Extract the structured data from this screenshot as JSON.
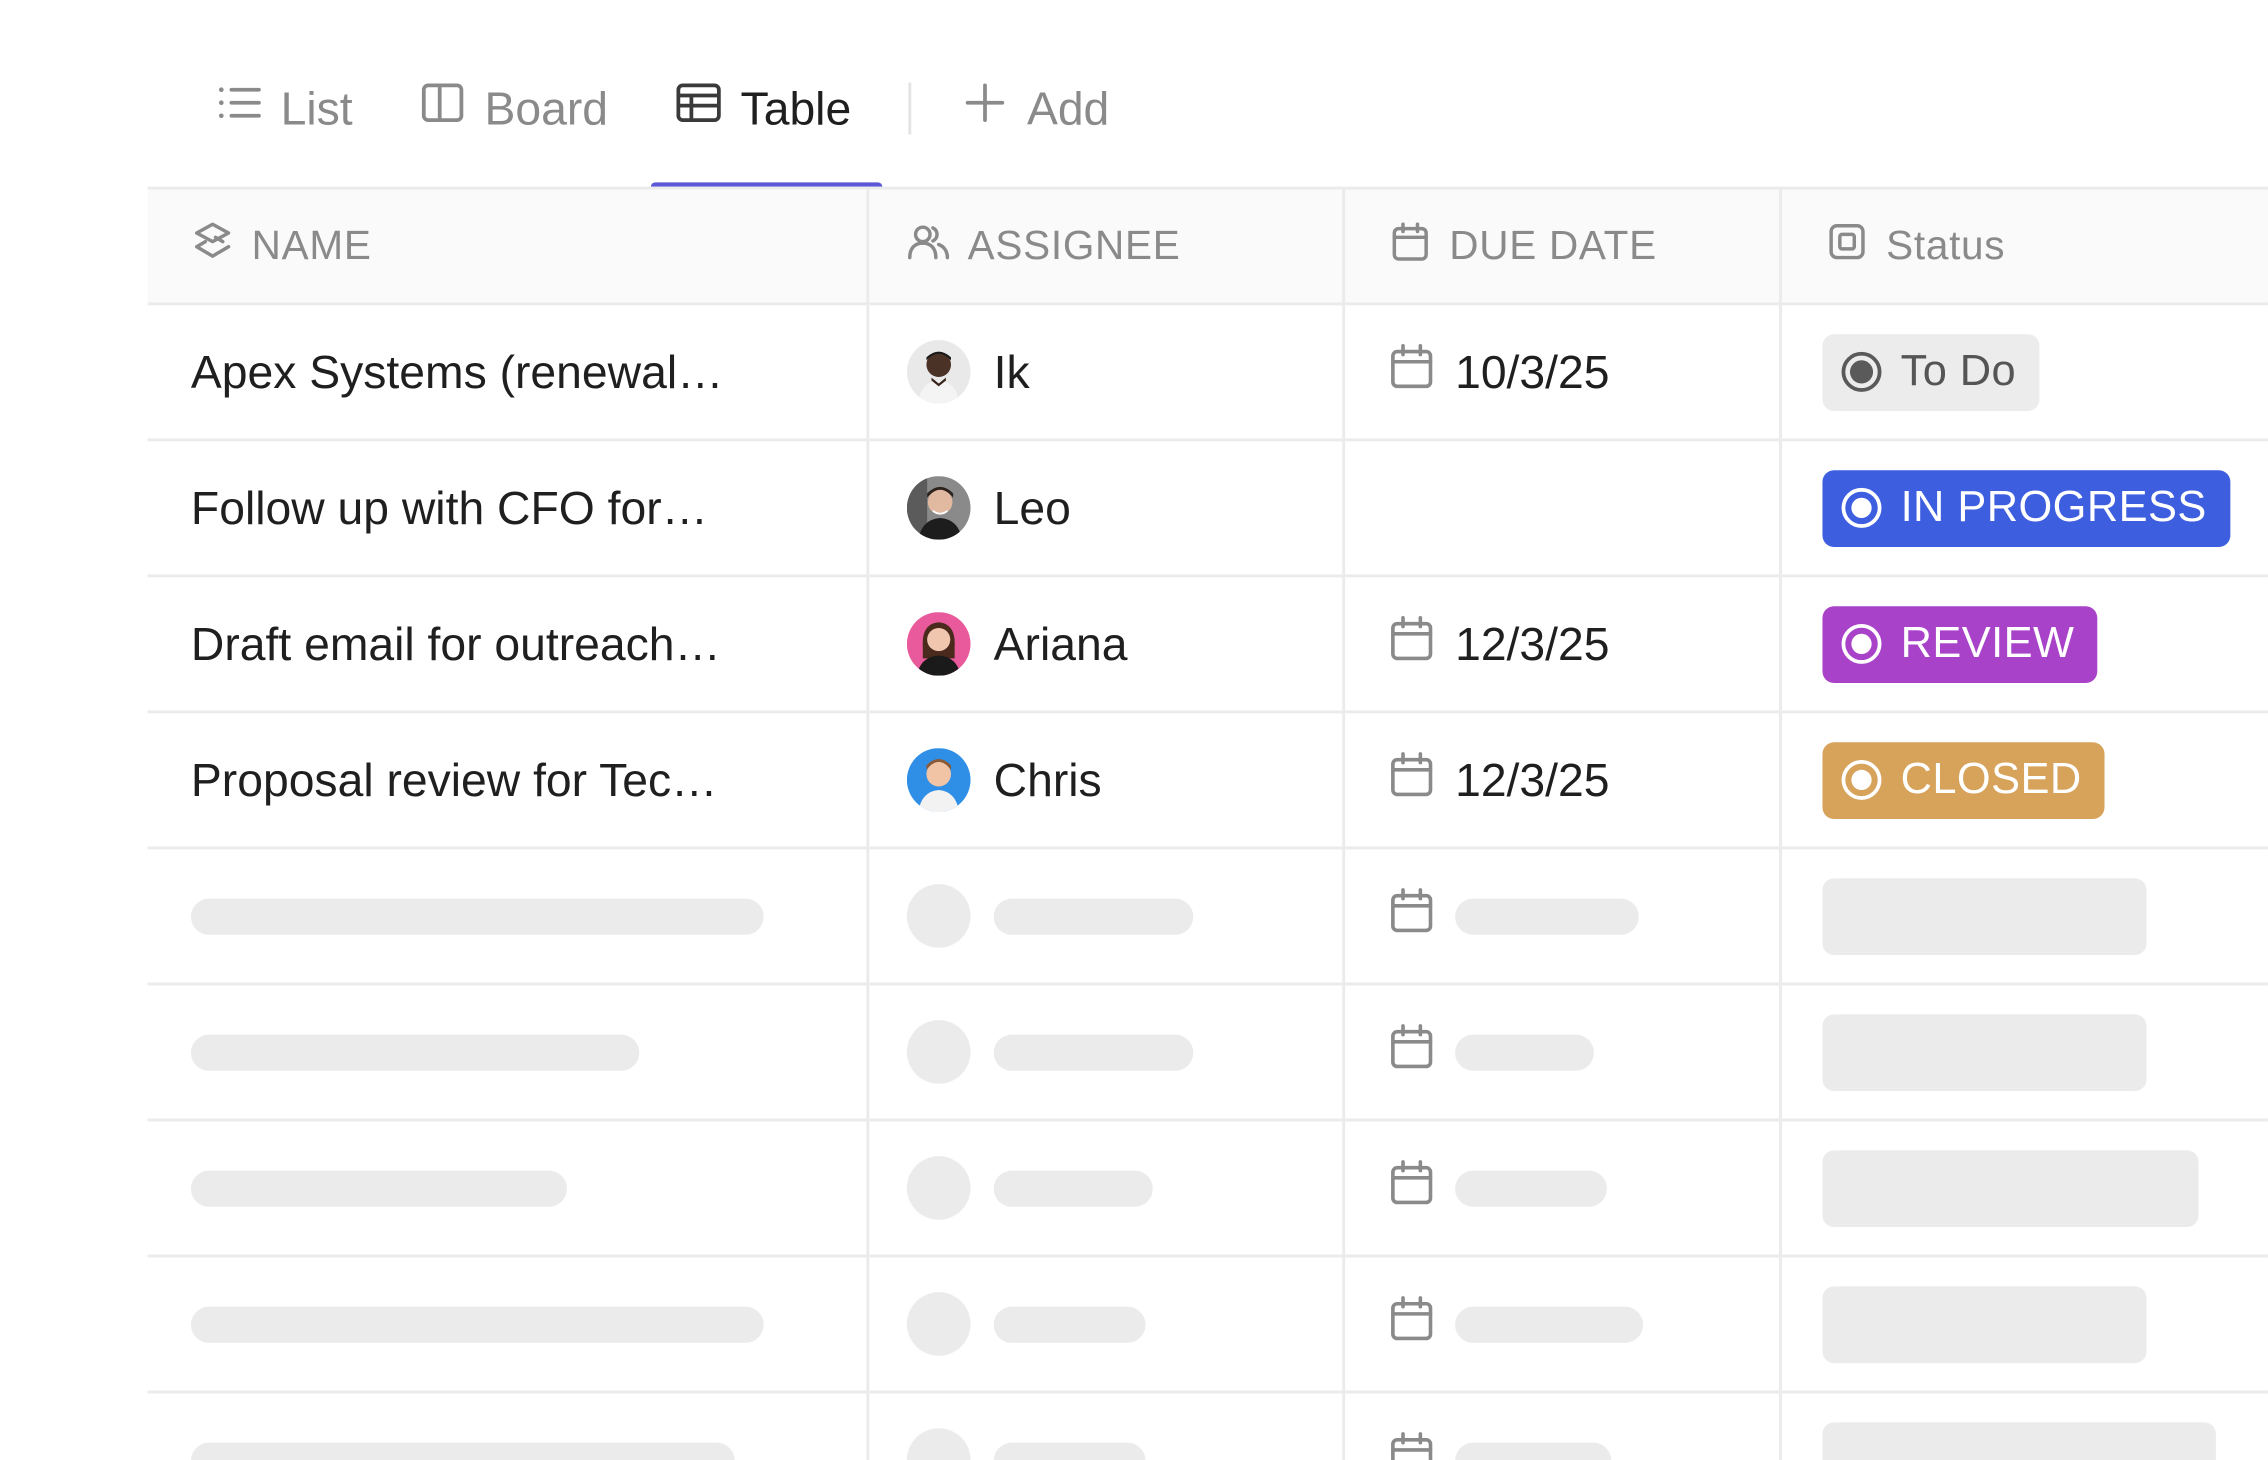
{
  "tabs": [
    {
      "label": "List",
      "icon": "list-icon"
    },
    {
      "label": "Board",
      "icon": "board-icon"
    },
    {
      "label": "Table",
      "icon": "table-icon",
      "active": true
    },
    {
      "label": "Add",
      "icon": "plus-icon"
    }
  ],
  "accent_color": "#5b57d6",
  "columns": {
    "name": "NAME",
    "assignee": "ASSIGNEE",
    "due_date": "DUE DATE",
    "status": "Status"
  },
  "rows": [
    {
      "name": "Apex Systems (renewal…",
      "assignee": "Ik",
      "due": "10/3/25",
      "status": "To Do"
    },
    {
      "name": "Follow up with CFO for…",
      "assignee": "Leo",
      "due": "",
      "status": "IN PROGRESS"
    },
    {
      "name": "Draft email for outreach…",
      "assignee": "Ariana",
      "due": "12/3/25",
      "status": "REVIEW"
    },
    {
      "name": "Proposal review for Tec…",
      "assignee": "Chris",
      "due": "12/3/25",
      "status": "CLOSED"
    }
  ],
  "status_colors": {
    "todo": "#ececec",
    "in_progress": "#3e5ee0",
    "review": "#a842c8",
    "closed": "#d7a25a"
  }
}
